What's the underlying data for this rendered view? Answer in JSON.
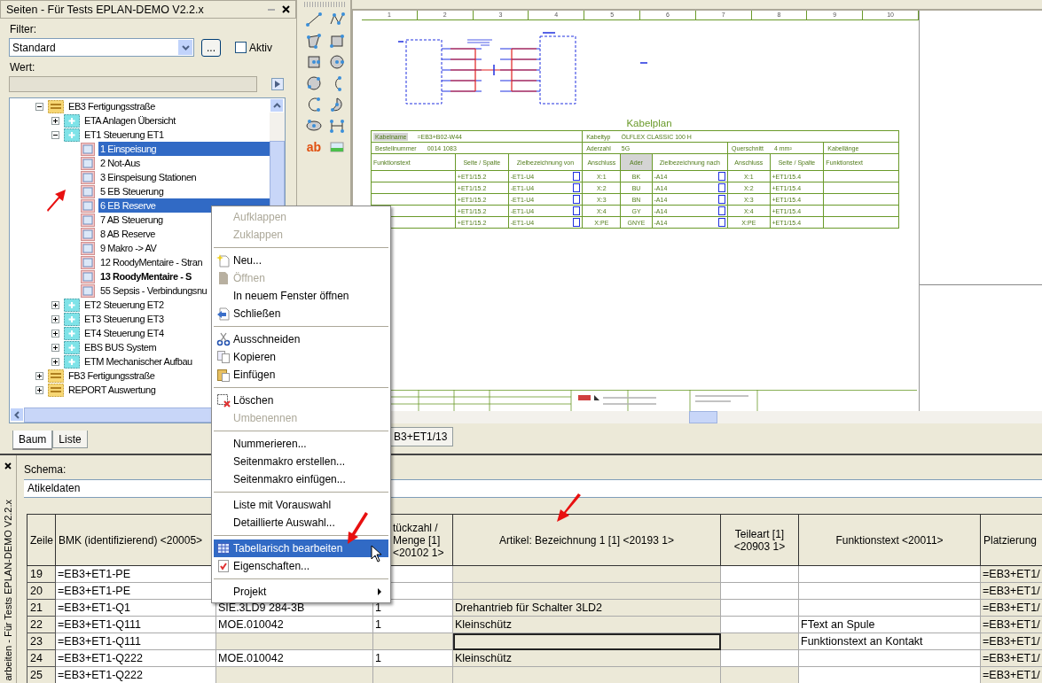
{
  "panel": {
    "title": "Seiten - Für Tests EPLAN-DEMO V2.2.x",
    "filter_label": "Filter:",
    "filter_value": "Standard",
    "more_button": "...",
    "aktiv_label": "Aktiv",
    "aktiv_checked": false,
    "wert_label": "Wert:",
    "tree": [
      {
        "label": "EB3 Fertigungsstraße",
        "kind": "structure",
        "expanded": true,
        "selected": false,
        "children": [
          {
            "label": "ETA Anlagen Übersicht",
            "kind": "folder",
            "expanded": false,
            "selected": false
          },
          {
            "label": "ET1 Steuerung ET1",
            "kind": "folder",
            "expanded": true,
            "selected": false,
            "children": [
              {
                "label": "1 Einspeisung",
                "kind": "page",
                "selected": true,
                "open": false
              },
              {
                "label": "2 Not-Aus",
                "kind": "page",
                "selected": false,
                "open": false
              },
              {
                "label": "3 Einspeisung Stationen",
                "kind": "page",
                "selected": false,
                "open": false
              },
              {
                "label": "5 EB Steuerung",
                "kind": "page",
                "selected": false,
                "open": false
              },
              {
                "label": "6 EB Reserve",
                "kind": "page",
                "selected": true,
                "open": false
              },
              {
                "label": "7 AB Steuerung",
                "kind": "page",
                "selected": false,
                "open": false
              },
              {
                "label": "8 AB Reserve",
                "kind": "page",
                "selected": false,
                "open": false
              },
              {
                "label": "9 Makro -> AV",
                "kind": "page",
                "selected": false,
                "open": false
              },
              {
                "label": "12 RoodyMentaire - Stran",
                "kind": "page",
                "selected": false,
                "open": false
              },
              {
                "label": "13 RoodyMentaire - S",
                "kind": "page",
                "selected": false,
                "open": true
              },
              {
                "label": "55 Sepsis - Verbindungsnu",
                "kind": "page",
                "selected": false,
                "open": false
              }
            ]
          },
          {
            "label": "ET2 Steuerung ET2",
            "kind": "folder",
            "expanded": false,
            "selected": false
          },
          {
            "label": "ET3 Steuerung ET3",
            "kind": "folder",
            "expanded": false,
            "selected": false
          },
          {
            "label": "ET4 Steuerung ET4",
            "kind": "folder",
            "expanded": false,
            "selected": false
          },
          {
            "label": "EBS BUS System",
            "kind": "folder",
            "expanded": false,
            "selected": false
          },
          {
            "label": "ETM Mechanischer Aufbau",
            "kind": "folder",
            "expanded": false,
            "selected": false
          }
        ]
      },
      {
        "label": "FB3 Fertigungsstraße",
        "kind": "structure",
        "expanded": false,
        "selected": false
      },
      {
        "label": "REPORT Auswertung",
        "kind": "structure",
        "expanded": false,
        "selected": false
      }
    ],
    "tabs": [
      {
        "label": "Baum",
        "selected": true
      },
      {
        "label": "Liste",
        "selected": false
      }
    ]
  },
  "toolbar": {
    "text_tool": "ab"
  },
  "document_tabs": [
    {
      "label": "B3+ET1/13",
      "selected": true
    }
  ],
  "sheet": {
    "column_numbers": [
      "1",
      "2",
      "3",
      "4",
      "5",
      "6",
      "7",
      "8",
      "9",
      "10"
    ],
    "cable_plan": {
      "title": "Kabelplan",
      "fields": [
        {
          "label": "Kabelname",
          "value": "=EB3+B02-W44"
        },
        {
          "label": "Kabeltyp",
          "value": "ÖLFLEX CLASSIC 100 H"
        },
        {
          "label": "Bestellnummer",
          "value": "0014 1083"
        },
        {
          "label": "Aderzahl",
          "value": "5G"
        },
        {
          "label": "Querschnitt",
          "value": "4 mm²"
        },
        {
          "label": "Kabellänge"
        }
      ],
      "columns": [
        "Funktionstext",
        "Seite / Spalte",
        "Zielbezeichnung von",
        "Anschluss",
        "Ader",
        "Zielbezeichnung nach",
        "Anschluss",
        "Seite / Spalte",
        "Funktionstext"
      ],
      "rows": [
        {
          "seite_von": "+ET1/15.2",
          "ziel_von": "-ET1-U4",
          "anschluss_von": "X:1",
          "ader": "BK",
          "ziel_nach": "-A14",
          "anschluss_nach": "X:1",
          "seite_nach": "+ET1/15.4"
        },
        {
          "seite_von": "+ET1/15.2",
          "ziel_von": "-ET1-U4",
          "anschluss_von": "X:2",
          "ader": "BU",
          "ziel_nach": "-A14",
          "anschluss_nach": "X:2",
          "seite_nach": "+ET1/15.4"
        },
        {
          "seite_von": "+ET1/15.2",
          "ziel_von": "-ET1-U4",
          "anschluss_von": "X:3",
          "ader": "BN",
          "ziel_nach": "-A14",
          "anschluss_nach": "X:3",
          "seite_nach": "+ET1/15.4"
        },
        {
          "seite_von": "+ET1/15.2",
          "ziel_von": "-ET1-U4",
          "anschluss_von": "X:4",
          "ader": "GY",
          "ziel_nach": "-A14",
          "anschluss_nach": "X:4",
          "seite_nach": "+ET1/15.4"
        },
        {
          "seite_von": "+ET1/15.2",
          "ziel_von": "-ET1-U4",
          "anschluss_von": "X:PE",
          "ader": "GNYE",
          "ziel_nach": "-A14",
          "anschluss_nach": "X:PE",
          "seite_nach": "+ET1/15.4"
        }
      ]
    }
  },
  "bottom_panel": {
    "side_title": "arbeiten - Für Tests EPLAN-DEMO V2.2.x",
    "schema_label": "Schema:",
    "schema_value": "Atikeldaten",
    "columns": [
      "Zeile",
      "BMK (identifizierend) <20005>",
      null,
      "tückzahl / Menge [1] <20102 1>",
      "Artikel: Bezeichnung 1 [1] <20193 1>",
      "Teileart [1] <20903 1>",
      "Funktionstext <20011>",
      "Platzierung"
    ],
    "rows": [
      {
        "zeile": "19",
        "bmk": "=EB3+ET1-PE",
        "platzierung": "=EB3+ET1/",
        "editable": true,
        "selected": false
      },
      {
        "zeile": "20",
        "bmk": "=EB3+ET1-PE",
        "platzierung": "=EB3+ET1/",
        "editable": true,
        "selected": false
      },
      {
        "zeile": "21",
        "bmk": "=EB3+ET1-Q1",
        "artikelnummer": "SIE.3LD9 284-3B",
        "stueckzahl": "1",
        "bezeichnung": "Drehantrieb für Schalter 3LD2",
        "platzierung": "=EB3+ET1/",
        "editable": true,
        "selected": false
      },
      {
        "zeile": "22",
        "bmk": "=EB3+ET1-Q111",
        "artikelnummer": "MOE.010042",
        "stueckzahl": "1",
        "bezeichnung": "Kleinschütz",
        "funktionstext": "FText an Spule",
        "platzierung": "=EB3+ET1/",
        "editable": true,
        "selected": false
      },
      {
        "zeile": "23",
        "bmk": "=EB3+ET1-Q111",
        "funktionstext": "Funktionstext an Kontakt",
        "platzierung": "=EB3+ET1/",
        "editable": false,
        "selected": true
      },
      {
        "zeile": "24",
        "bmk": "=EB3+ET1-Q222",
        "artikelnummer": "MOE.010042",
        "stueckzahl": "1",
        "bezeichnung": "Kleinschütz",
        "platzierung": "=EB3+ET1/",
        "editable": true,
        "selected": false
      },
      {
        "zeile": "25",
        "bmk": "=EB3+ET1-Q222",
        "platzierung": "=EB3+ET1/",
        "editable": false,
        "selected": false
      }
    ]
  },
  "context_menu": {
    "groups": [
      [
        {
          "label": "Aufklappen",
          "disabled": true,
          "selected": false
        },
        {
          "label": "Zuklappen",
          "disabled": true,
          "selected": false
        }
      ],
      [
        {
          "label": "Neu...",
          "disabled": false,
          "selected": false
        },
        {
          "label": "Öffnen",
          "disabled": true,
          "selected": false
        },
        {
          "label": "In neuem Fenster öffnen",
          "disabled": false,
          "selected": false
        },
        {
          "label": "Schließen",
          "disabled": false,
          "selected": false
        }
      ],
      [
        {
          "label": "Ausschneiden",
          "disabled": false,
          "selected": false
        },
        {
          "label": "Kopieren",
          "disabled": false,
          "selected": false
        },
        {
          "label": "Einfügen",
          "disabled": false,
          "selected": false
        }
      ],
      [
        {
          "label": "Löschen",
          "disabled": false,
          "selected": false
        },
        {
          "label": "Umbenennen",
          "disabled": true,
          "selected": false
        }
      ],
      [
        {
          "label": "Nummerieren...",
          "disabled": false,
          "selected": false
        },
        {
          "label": "Seitenmakro erstellen...",
          "disabled": false,
          "selected": false
        },
        {
          "label": "Seitenmakro einfügen...",
          "disabled": false,
          "selected": false
        }
      ],
      [
        {
          "label": "Liste mit Vorauswahl",
          "disabled": false,
          "selected": false
        },
        {
          "label": "Detaillierte Auswahl...",
          "disabled": false,
          "selected": false
        }
      ],
      [
        {
          "label": "Tabellarisch bearbeiten",
          "disabled": false,
          "selected": true
        },
        {
          "label": "Eigenschaften...",
          "disabled": false,
          "selected": false
        }
      ],
      [
        {
          "label": "Projekt",
          "disabled": false,
          "selected": false,
          "submenu": true
        }
      ]
    ]
  }
}
